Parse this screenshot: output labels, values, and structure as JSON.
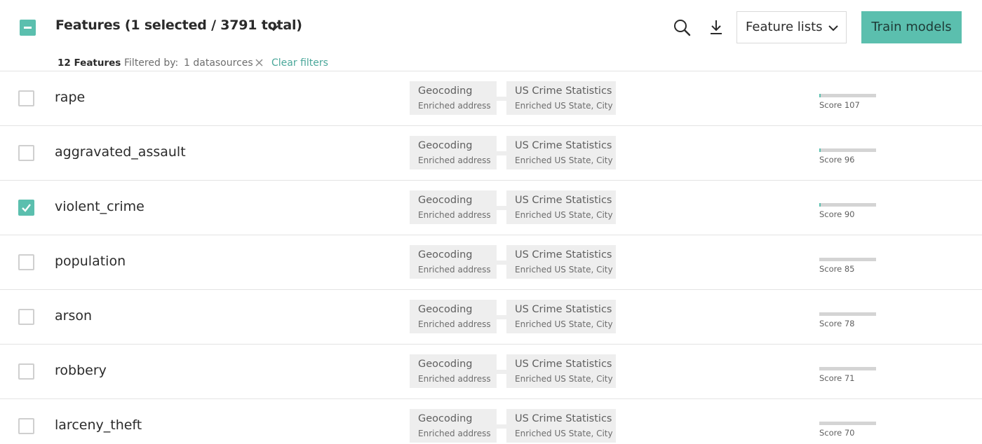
{
  "header": {
    "title": "Features (1 selected / 3791 total)",
    "feature_lists_label": "Feature lists",
    "train_models_label": "Train models",
    "accent_color": "#5bbfae"
  },
  "filter_bar": {
    "count": "12 Features",
    "filtered_by_label": "Filtered by:",
    "filter_value": "1 datasources",
    "clear_filters_label": "Clear filters"
  },
  "rows": [
    {
      "name": "rape",
      "checked": false,
      "source1": {
        "title": "Geocoding",
        "subtitle": "Enriched address"
      },
      "source2": {
        "title": "US Crime Statistics",
        "subtitle": "Enriched US State, City"
      },
      "score_label": "Score 107",
      "score_fill": 0.025
    },
    {
      "name": "aggravated_assault",
      "checked": false,
      "source1": {
        "title": "Geocoding",
        "subtitle": "Enriched address"
      },
      "source2": {
        "title": "US Crime Statistics",
        "subtitle": "Enriched US State, City"
      },
      "score_label": "Score 96",
      "score_fill": 0.022
    },
    {
      "name": "violent_crime",
      "checked": true,
      "source1": {
        "title": "Geocoding",
        "subtitle": "Enriched address"
      },
      "source2": {
        "title": "US Crime Statistics",
        "subtitle": "Enriched US State, City"
      },
      "score_label": "Score 90",
      "score_fill": 0.02
    },
    {
      "name": "population",
      "checked": false,
      "source1": {
        "title": "Geocoding",
        "subtitle": "Enriched address"
      },
      "source2": {
        "title": "US Crime Statistics",
        "subtitle": "Enriched US State, City"
      },
      "score_label": "Score 85",
      "score_fill": 0.0
    },
    {
      "name": "arson",
      "checked": false,
      "source1": {
        "title": "Geocoding",
        "subtitle": "Enriched address"
      },
      "source2": {
        "title": "US Crime Statistics",
        "subtitle": "Enriched US State, City"
      },
      "score_label": "Score 78",
      "score_fill": 0.0
    },
    {
      "name": "robbery",
      "checked": false,
      "source1": {
        "title": "Geocoding",
        "subtitle": "Enriched address"
      },
      "source2": {
        "title": "US Crime Statistics",
        "subtitle": "Enriched US State, City"
      },
      "score_label": "Score 71",
      "score_fill": 0.0
    },
    {
      "name": "larceny_theft",
      "checked": false,
      "source1": {
        "title": "Geocoding",
        "subtitle": "Enriched address"
      },
      "source2": {
        "title": "US Crime Statistics",
        "subtitle": "Enriched US State, City"
      },
      "score_label": "Score 70",
      "score_fill": 0.0
    }
  ]
}
